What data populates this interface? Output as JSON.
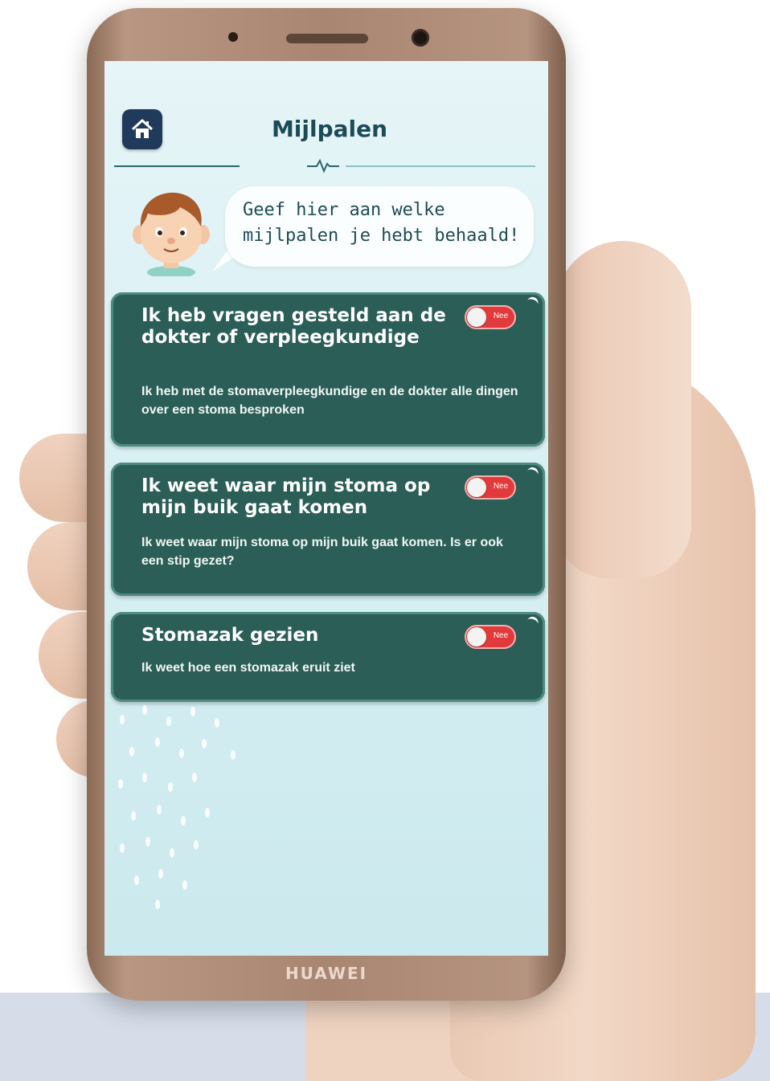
{
  "phone": {
    "brand": "HUAWEI"
  },
  "header": {
    "title": "Mijlpalen"
  },
  "speech": {
    "text": "Geef hier aan welke\nmijlpalen je hebt behaald!"
  },
  "milestones": [
    {
      "title": "Ik heb vragen gesteld aan de dokter of verpleegkundige",
      "description": "Ik heb met de stomaverpleegkundige en de dokter alle dingen over een stoma besproken",
      "toggle_label": "Nee",
      "checked": false
    },
    {
      "title": "Ik weet waar mijn stoma op mijn buik gaat komen",
      "description": "Ik weet waar mijn stoma op mijn buik gaat komen. Is er ook een stip gezet?",
      "toggle_label": "Nee",
      "checked": false
    },
    {
      "title": "Stomazak gezien",
      "description": "Ik weet hoe een stomazak eruit ziet",
      "toggle_label": "Nee",
      "checked": false
    }
  ],
  "colors": {
    "card": "#2a5e56",
    "toggle_off": "#e23a3a",
    "title": "#1c4a57",
    "home_button": "#1f3a5b"
  },
  "icons": {
    "home": "home-icon"
  }
}
